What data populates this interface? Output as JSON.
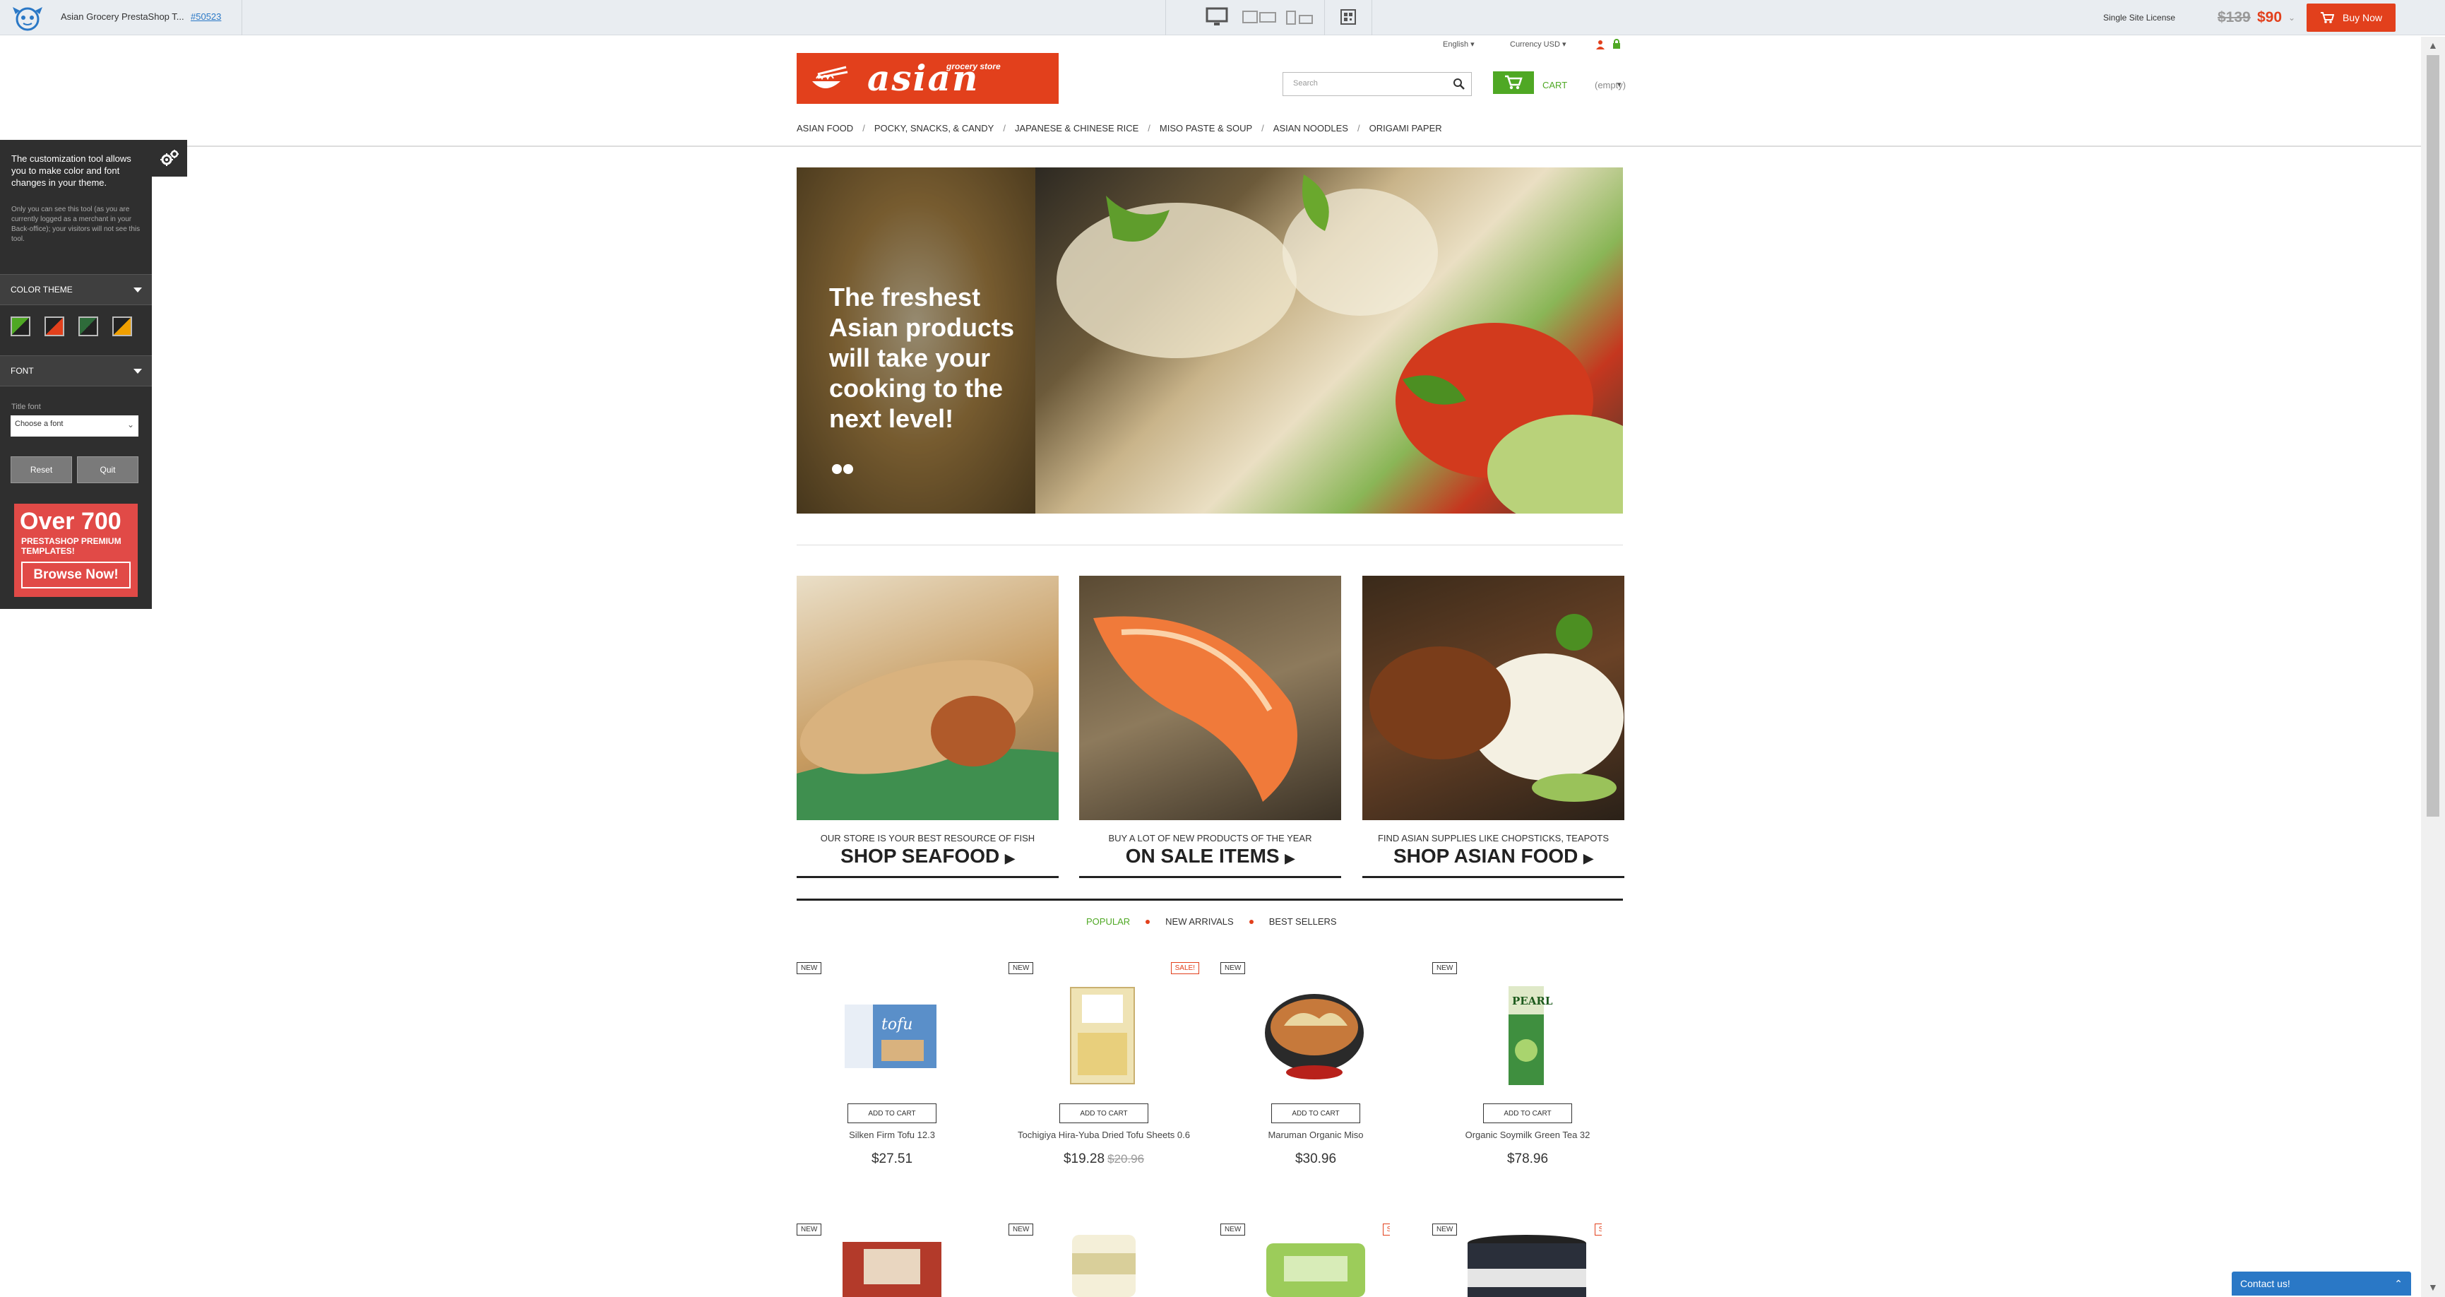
{
  "topbar": {
    "title": "Asian Grocery PrestaShop T...",
    "template_id": "#50523",
    "license": "Single Site License",
    "old_price": "$139",
    "new_price": "$90",
    "buy_label": "Buy Now"
  },
  "header": {
    "language": "English",
    "currency": "Currency USD",
    "logo_text": "asian",
    "logo_subtext": "grocery store",
    "search_placeholder": "Search",
    "cart_label": "CART",
    "cart_status": "(empty)"
  },
  "nav": [
    "ASIAN FOOD",
    "POCKY, SNACKS, & CANDY",
    "JAPANESE & CHINESE RICE",
    "MISO PASTE & SOUP",
    "ASIAN NOODLES",
    "ORIGAMI PAPER"
  ],
  "customizer": {
    "intro": "The customization tool allows you to make color and font changes in your theme.",
    "note": "Only you can see this tool (as you are currently logged as a merchant in your Back-office); your visitors will not see this tool.",
    "color_theme_label": "COLOR THEME",
    "font_label": "FONT",
    "title_font_label": "Title font",
    "font_select": "Choose a font",
    "reset_label": "Reset",
    "quit_label": "Quit",
    "promo_big": "Over 700",
    "promo_small": "PRESTASHOP PREMIUM TEMPLATES!",
    "promo_button": "Browse Now!"
  },
  "hero": {
    "text": "The freshest Asian products will take your cooking to the next level!"
  },
  "banners": [
    {
      "sub": "OUR STORE IS YOUR BEST RESOURCE OF FISH",
      "title": "SHOP SEAFOOD"
    },
    {
      "sub": "BUY A LOT OF NEW PRODUCTS OF THE YEAR",
      "title": "ON SALE ITEMS"
    },
    {
      "sub": "FIND ASIAN SUPPLIES LIKE CHOPSTICKS, TEAPOTS",
      "title": "SHOP ASIAN FOOD"
    }
  ],
  "tabs": [
    "POPULAR",
    "NEW ARRIVALS",
    "BEST SELLERS"
  ],
  "product_labels": {
    "new": "NEW",
    "sale": "SALE!",
    "add_to_cart": "ADD TO CART"
  },
  "products": [
    {
      "name": "Silken Firm Tofu 12.3",
      "price": "$27.51",
      "old_price": ""
    },
    {
      "name": "Tochigiya Hira-Yuba Dried Tofu Sheets 0.6",
      "price": "$19.28",
      "old_price": "$20.96"
    },
    {
      "name": "Maruman Organic Miso",
      "price": "$30.96",
      "old_price": ""
    },
    {
      "name": "Organic Soymilk Green Tea 32",
      "price": "$78.96",
      "old_price": ""
    }
  ],
  "contact_label": "Contact us!",
  "colors": {
    "brand_red": "#e2401c",
    "accent_green": "#4fa824",
    "panel_dark": "#2f2f2f",
    "contact_blue": "#2a78c6"
  }
}
